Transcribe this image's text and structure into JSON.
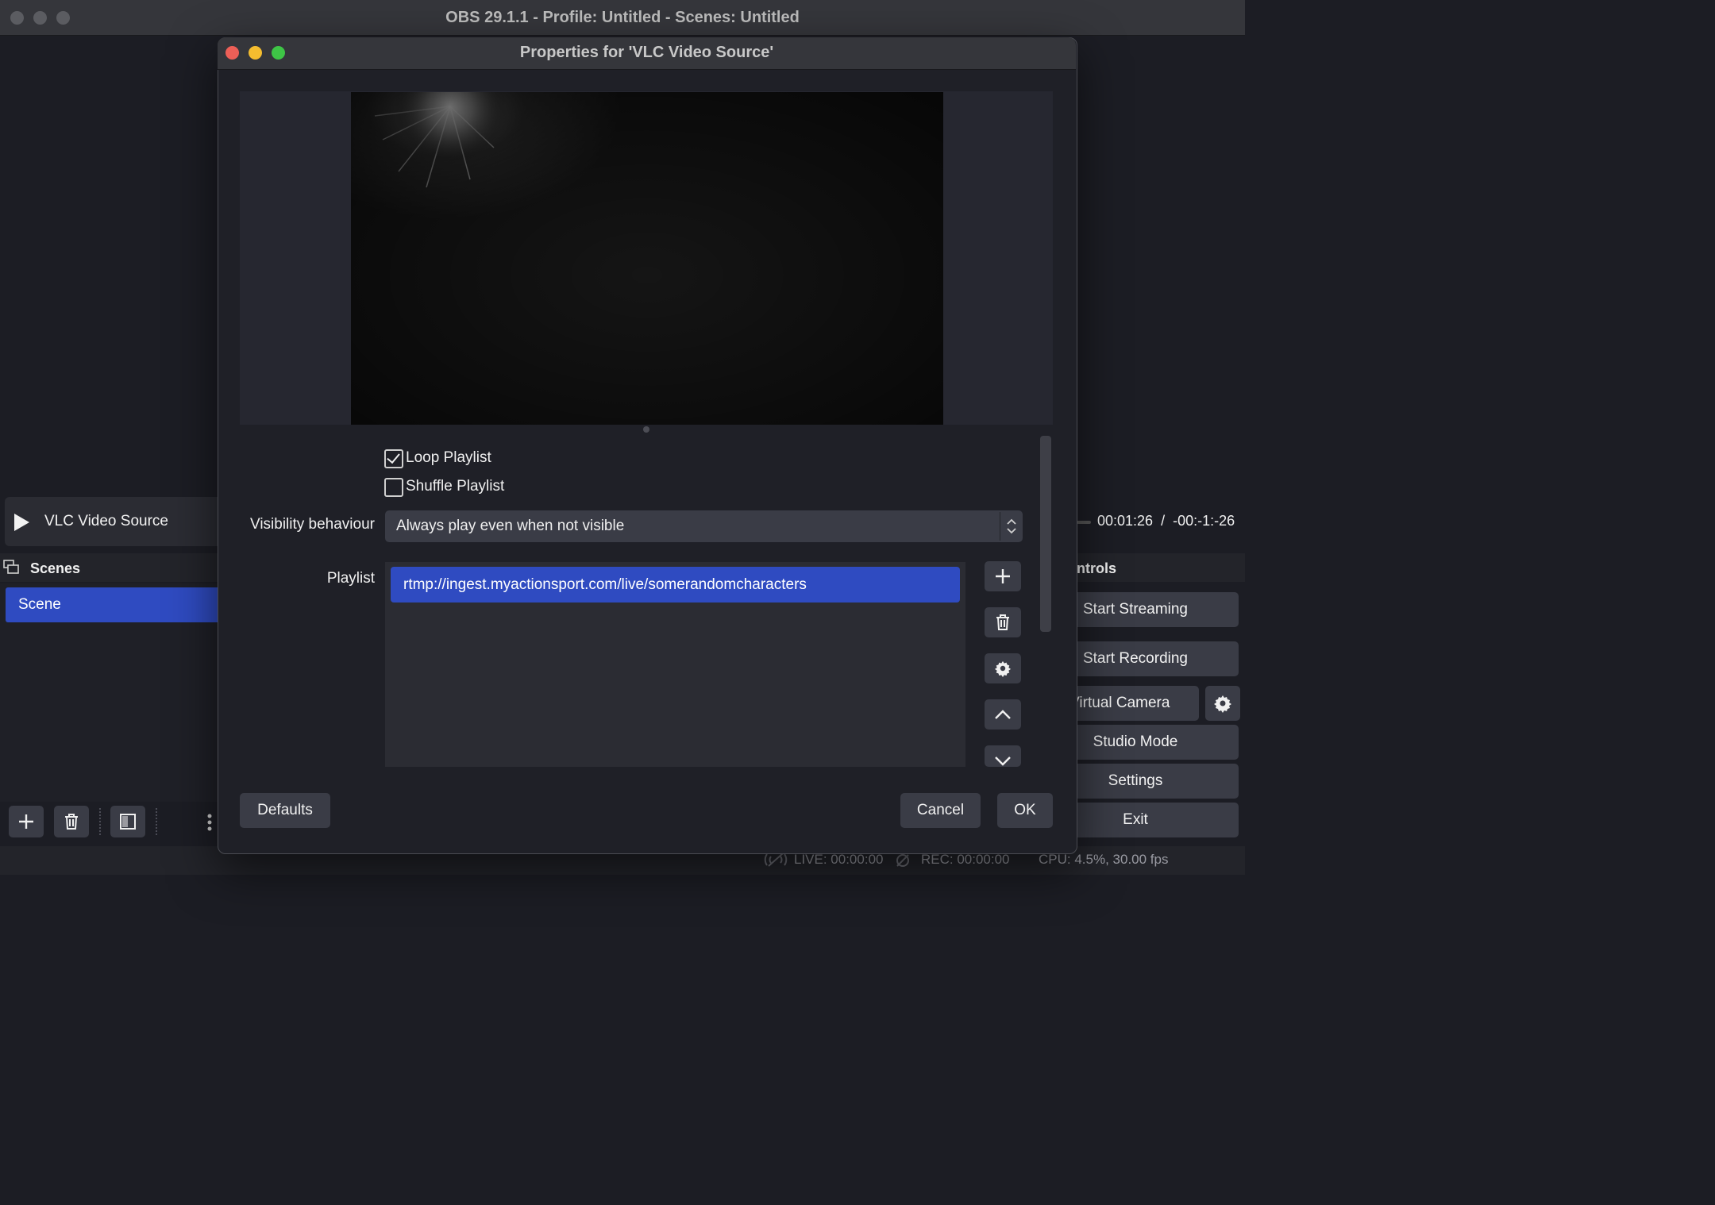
{
  "main_window": {
    "title": "OBS 29.1.1 - Profile: Untitled - Scenes: Untitled"
  },
  "preview_bar": {
    "source_name": "VLC Video Source",
    "timecode": "00:01:26  /  -00:-1:-26"
  },
  "scenes_dock": {
    "title": "Scenes",
    "items": [
      {
        "label": "Scene",
        "selected": true
      }
    ]
  },
  "controls_dock": {
    "title": "ntrols",
    "buttons": {
      "start_streaming": "Start Streaming",
      "start_recording": "Start Recording",
      "virtual_camera": "t Virtual Camera",
      "studio_mode": "Studio Mode",
      "settings": "Settings",
      "exit": "Exit"
    }
  },
  "status_bar": {
    "live": "LIVE: 00:00:00",
    "rec": "REC: 00:00:00",
    "cpu": "CPU: 4.5%, 30.00 fps"
  },
  "dialog": {
    "title": "Properties for 'VLC Video Source'",
    "loop_playlist": {
      "label": "Loop Playlist",
      "checked": true
    },
    "shuffle_playlist": {
      "label": "Shuffle Playlist",
      "checked": false
    },
    "visibility": {
      "label": "Visibility behaviour",
      "value": "Always play even when not visible"
    },
    "playlist": {
      "label": "Playlist",
      "items": [
        "rtmp://ingest.myactionsport.com/live/somerandomcharacters"
      ]
    },
    "buttons": {
      "defaults": "Defaults",
      "cancel": "Cancel",
      "ok": "OK"
    }
  },
  "colors": {
    "accent": "#2f4bc1",
    "button": "#3a3c46",
    "background": "#1c1d24",
    "close": "#ed5f57",
    "minimize": "#f5bd2f",
    "zoom": "#3ec546"
  }
}
